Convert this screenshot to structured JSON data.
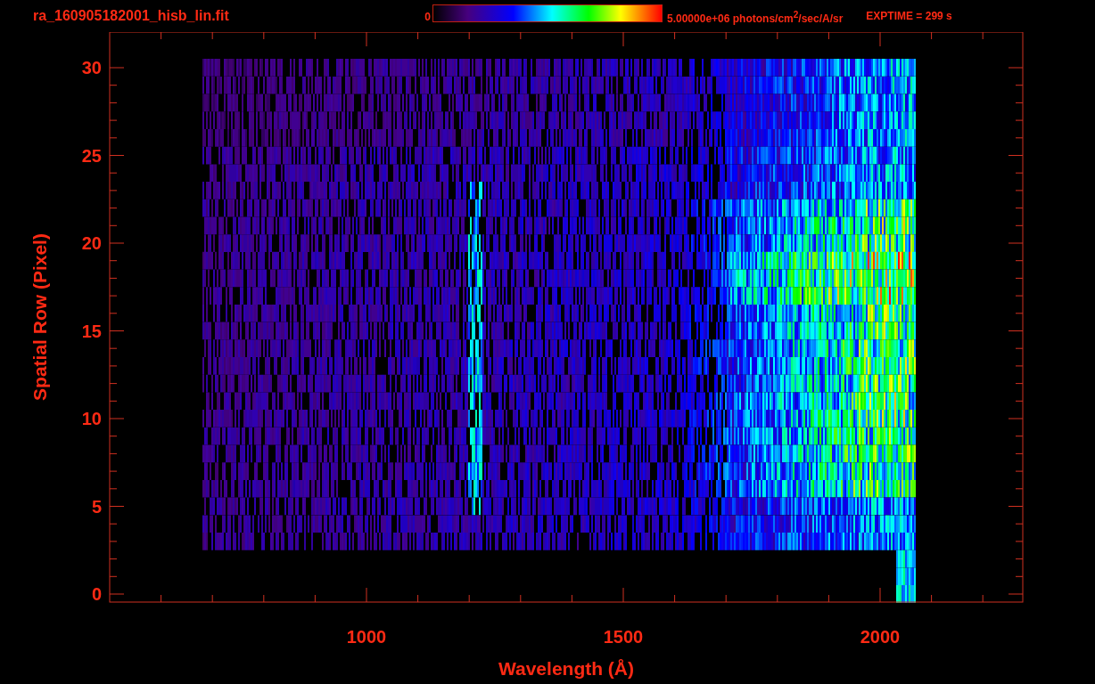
{
  "title": "ra_160905182001_hisb_lin.fit",
  "colorbar": {
    "min_label": "0",
    "max_label": "5.00000e+06 photons/cm$^{2}$/sec/A/sr"
  },
  "exposure": "EXPTIME = 299 s",
  "plot": {
    "x_axis": {
      "label": "Wavelength (Å)",
      "tick_labels": [
        "1000",
        "1500",
        "2000"
      ]
    },
    "y_axis": {
      "label": "Spatial Row (Pixel)",
      "tick_labels": [
        "30",
        "25",
        "20",
        "15",
        "10",
        "5",
        "0"
      ]
    }
  }
}
